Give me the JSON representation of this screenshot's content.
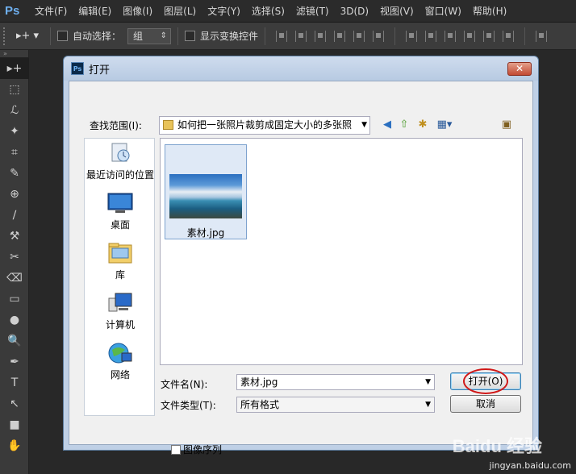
{
  "app": {
    "logo": "Ps"
  },
  "menu": [
    "文件(F)",
    "编辑(E)",
    "图像(I)",
    "图层(L)",
    "文字(Y)",
    "选择(S)",
    "滤镜(T)",
    "3D(D)",
    "视图(V)",
    "窗口(W)",
    "帮助(H)"
  ],
  "options": {
    "tool_preset": "▸+ ▾",
    "auto_select_label": "自动选择：",
    "auto_select_value": "组",
    "show_transform_label": "显示变换控件"
  },
  "tools": [
    "▸+",
    "⬚",
    "ℒ",
    "✦",
    "⌗",
    "✎",
    "⊕",
    "∕",
    "⚒",
    "✂",
    "⌫",
    "▭",
    "●",
    "🔍",
    "✒",
    "T",
    "↖",
    "■",
    "✋"
  ],
  "dialog": {
    "title": "打开",
    "close_label": "✕",
    "look_in_label": "查找范围(I):",
    "look_in_value": "如何把一张照片裁剪成固定大小的多张照",
    "places": [
      {
        "label": "最近访问的位置",
        "icon": "recent-places-icon"
      },
      {
        "label": "桌面",
        "icon": "desktop-icon"
      },
      {
        "label": "库",
        "icon": "libraries-icon"
      },
      {
        "label": "计算机",
        "icon": "computer-icon"
      },
      {
        "label": "网络",
        "icon": "network-icon"
      }
    ],
    "files": [
      {
        "name": "素材.jpg"
      }
    ],
    "file_name_label": "文件名(N):",
    "file_name_value": "素材.jpg",
    "file_type_label": "文件类型(T):",
    "file_type_value": "所有格式",
    "open_label": "打开(O)",
    "cancel_label": "取消",
    "image_sequence_label": "图像序列"
  },
  "watermark": {
    "brand": "Baidu 经验",
    "url": "jingyan.baidu.com"
  }
}
